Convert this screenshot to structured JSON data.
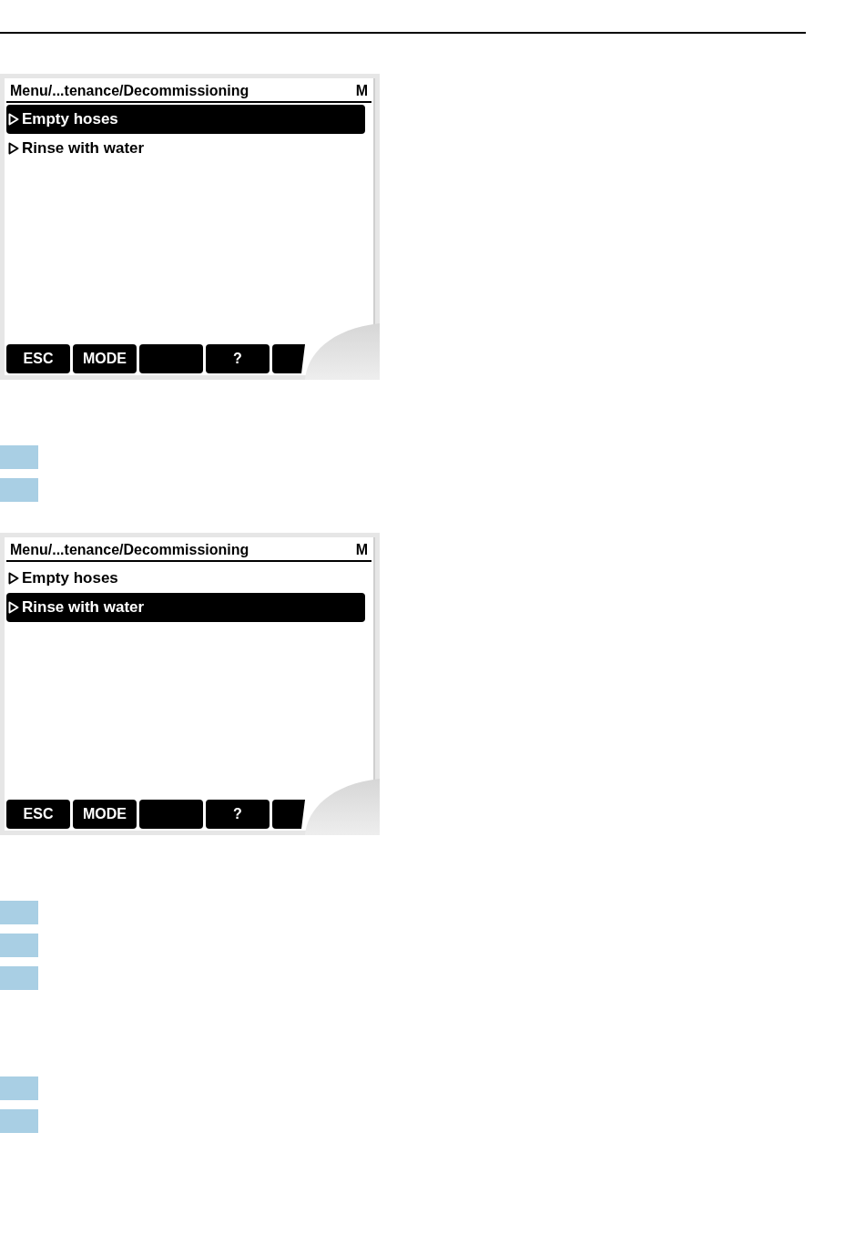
{
  "sections": [
    {
      "screen": {
        "title": "Menu/...tenance/Decommissioning",
        "mode_indicator": "M",
        "items": [
          {
            "label": "Empty hoses",
            "selected": true
          },
          {
            "label": "Rinse with water",
            "selected": false
          }
        ],
        "softkeys": [
          {
            "kind": "label",
            "label": "ESC"
          },
          {
            "kind": "label",
            "label": "MODE"
          },
          {
            "kind": "blank"
          },
          {
            "kind": "label",
            "label": "?"
          },
          {
            "kind": "partial"
          }
        ]
      },
      "steps": [
        {
          "kind": "marker"
        },
        {
          "kind": "marker"
        }
      ]
    },
    {
      "screen": {
        "title": "Menu/...tenance/Decommissioning",
        "mode_indicator": "M",
        "items": [
          {
            "label": "Empty hoses",
            "selected": false
          },
          {
            "label": "Rinse with water",
            "selected": true
          }
        ],
        "softkeys": [
          {
            "kind": "label",
            "label": "ESC"
          },
          {
            "kind": "label",
            "label": "MODE"
          },
          {
            "kind": "blank"
          },
          {
            "kind": "label",
            "label": "?"
          },
          {
            "kind": "partial"
          }
        ]
      },
      "steps": [
        {
          "kind": "marker"
        },
        {
          "kind": "marker"
        },
        {
          "kind": "marker"
        }
      ]
    },
    {
      "steps": [
        {
          "kind": "marker"
        },
        {
          "kind": "marker"
        }
      ]
    }
  ]
}
